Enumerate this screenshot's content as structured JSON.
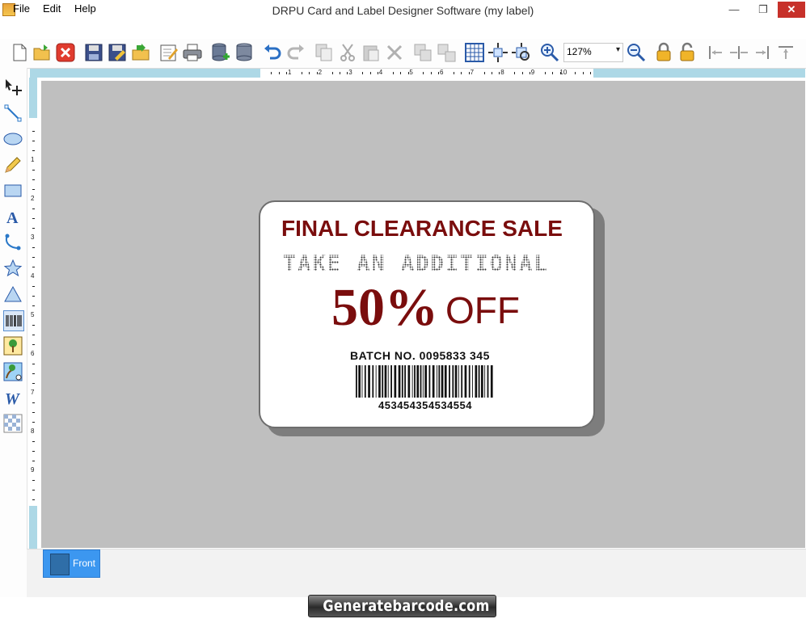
{
  "window": {
    "title": "DRPU Card and Label Designer Software  (my label)",
    "minimize_glyph": "—",
    "maximize_glyph": "❐",
    "close_glyph": "✕"
  },
  "menu": {
    "file": "File",
    "edit": "Edit",
    "help": "Help"
  },
  "toolbar": {
    "zoom_value": "127%",
    "icons": [
      "new-icon",
      "open-icon",
      "close-doc-icon",
      "save-icon",
      "save-as-icon",
      "export-icon",
      "edit-icon",
      "print-icon",
      "database-add-icon",
      "database-icon",
      "undo-icon",
      "redo-icon",
      "copy-icon",
      "cut-icon",
      "paste-icon",
      "delete-icon",
      "group-icon",
      "ungroup-icon",
      "grid-icon",
      "fit-icon",
      "center-icon",
      "zoom-in-icon",
      "zoom-out-icon",
      "lock-icon",
      "unlock-icon",
      "align-left-icon",
      "align-center-icon",
      "align-right-icon",
      "align-top-icon"
    ]
  },
  "left_tools": [
    "pointer-move-icon",
    "line-icon",
    "ellipse-icon",
    "pencil-icon",
    "rectangle-icon",
    "text-icon",
    "curve-icon",
    "star-icon",
    "triangle-icon",
    "barcode-icon",
    "image-icon",
    "image-library-icon",
    "wordart-icon",
    "pattern-icon"
  ],
  "ruler": {
    "h_labels": [
      "1",
      "2",
      "3",
      "4",
      "5",
      "6",
      "7",
      "8",
      "9",
      "10"
    ],
    "v_labels": [
      "1",
      "2",
      "3",
      "4",
      "5",
      "6",
      "7",
      "8",
      "9"
    ]
  },
  "label": {
    "headline": "FINAL CLEARANCE SALE",
    "subline": "TAKE AN ADDITIONAL",
    "discount": "50%",
    "off": "OFF",
    "batch": "BATCH NO. 0095833 345",
    "barcode_number": "453454354534554"
  },
  "tabs": {
    "front": "Front"
  },
  "brand": {
    "text": "Generatebarcode.com"
  },
  "colors": {
    "accent_red": "#7a0d0d",
    "canvas_gray": "#bfbfbf",
    "ruler_blue": "#add8e6",
    "tab_blue": "#3c97f0"
  }
}
